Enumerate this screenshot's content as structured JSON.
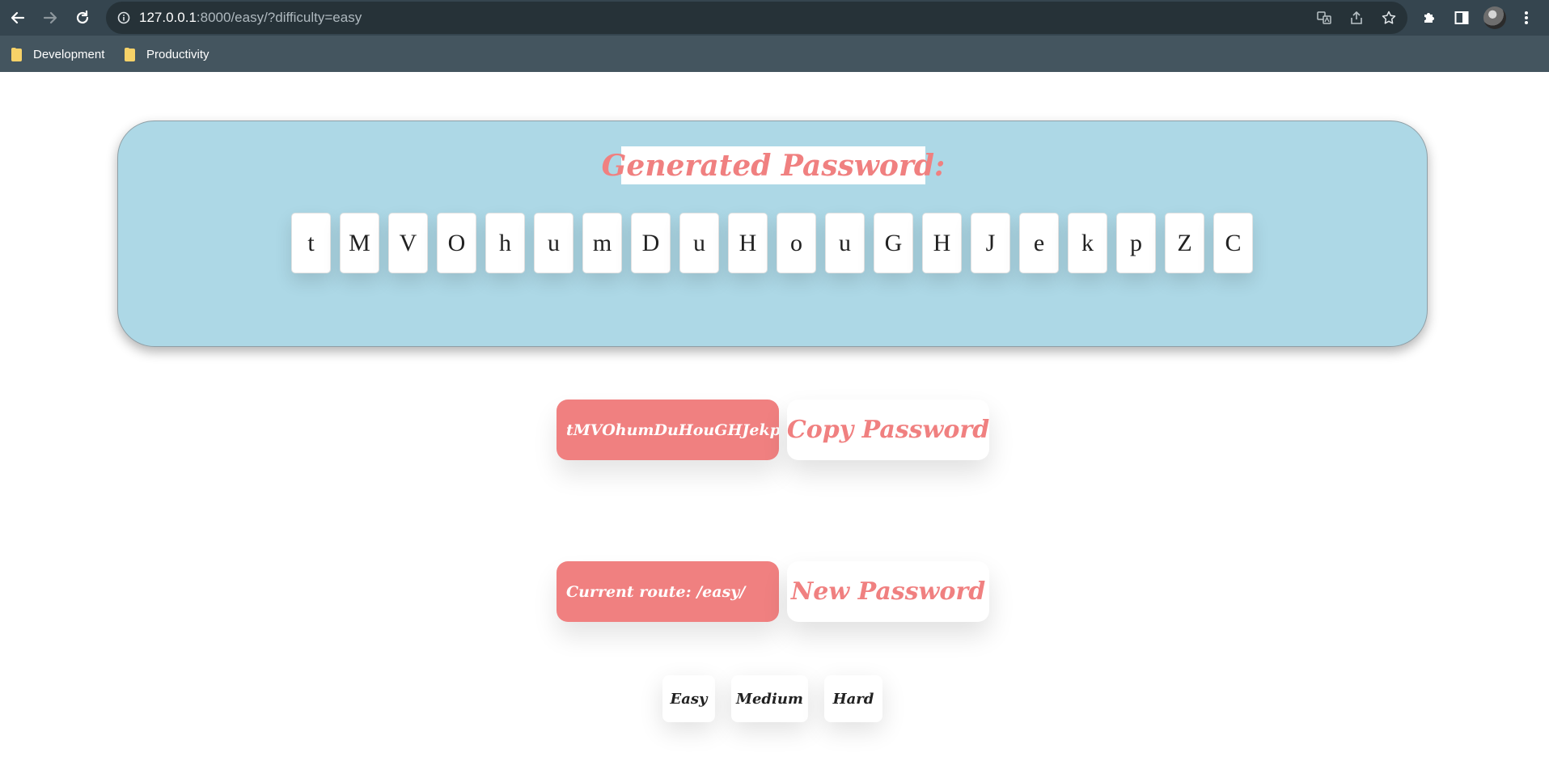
{
  "browser": {
    "url_host": "127.0.0.1",
    "url_rest": ":8000/easy/?difficulty=easy",
    "bookmarks": [
      {
        "label": "Development"
      },
      {
        "label": "Productivity"
      }
    ],
    "icons": {
      "back": "arrow-left-icon",
      "forward": "arrow-right-icon",
      "reload": "reload-icon",
      "site_info": "info-icon",
      "translate": "translate-icon",
      "share": "share-icon",
      "bookmark": "star-icon",
      "extensions": "puzzle-icon",
      "side_panel": "side-panel-icon",
      "menu": "kebab-menu-icon"
    }
  },
  "page": {
    "title": "Generated Password:",
    "characters": [
      "t",
      "M",
      "V",
      "O",
      "h",
      "u",
      "m",
      "D",
      "u",
      "H",
      "o",
      "u",
      "G",
      "H",
      "J",
      "e",
      "k",
      "p",
      "Z",
      "C"
    ],
    "password": "tMVOhumDuHouGHJekpZC",
    "copy_label": "Copy Password",
    "route_text": "Current route: /easy/",
    "new_label": "New Password",
    "difficulties": [
      "Easy",
      "Medium",
      "Hard"
    ]
  },
  "colors": {
    "accent": "#f08080",
    "card": "#add8e6",
    "chrome_toolbar": "#35454f",
    "chrome_bookmarks": "#44555f"
  }
}
